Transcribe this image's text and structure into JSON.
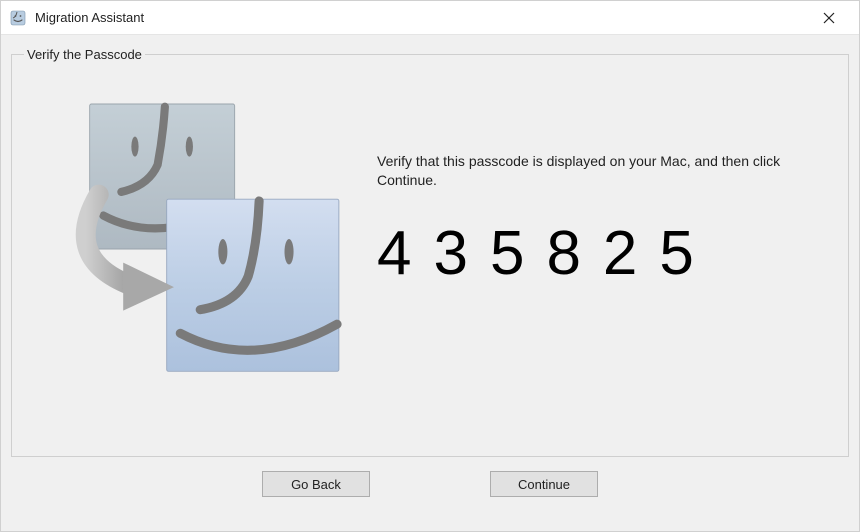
{
  "window": {
    "title": "Migration Assistant"
  },
  "section": {
    "title": "Verify the Passcode"
  },
  "main": {
    "instruction": "Verify that this passcode is displayed on your Mac, and then click Continue.",
    "passcode": "435825"
  },
  "buttons": {
    "back": "Go Back",
    "continue": "Continue"
  }
}
